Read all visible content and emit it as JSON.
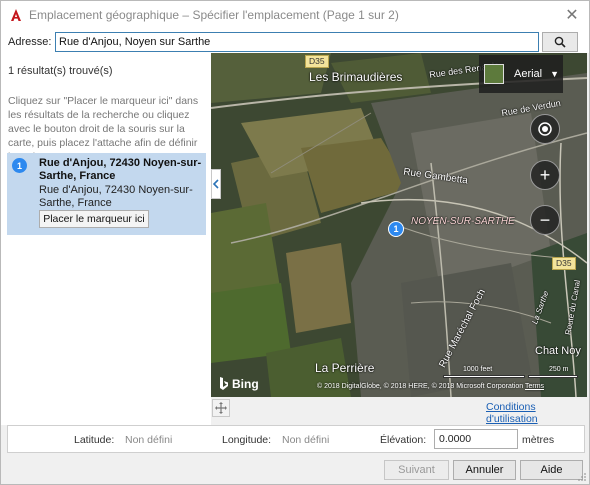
{
  "window": {
    "title": "Emplacement géographique – Spécifier l'emplacement (Page 1 sur 2)",
    "close_glyph": "✕",
    "app_icon": "autocad-a-icon",
    "accent": "#c4161c"
  },
  "address": {
    "label": "Adresse:",
    "value": "Rue d'Anjou, Noyen sur Sarthe",
    "search_icon": "search-icon"
  },
  "results": {
    "count_text": "1 résultat(s) trouvé(s)",
    "instructions": "Cliquez sur \"Placer le marqueur ici\" dans les résultats de la recherche ou cliquez avec le bouton droit de la souris sur la carte, puis placez l'attache afin de définir l'emplacement.",
    "items": [
      {
        "num": "1",
        "title": "Rue d'Anjou, 72430 Noyen-sur-Sarthe, France",
        "address": "Rue d'Anjou, 72430 Noyen-sur-Sarthe, France",
        "button": "Placer le marqueur ici"
      }
    ]
  },
  "map": {
    "style_label": "Aerial",
    "pin_label": "1",
    "labels": {
      "brimaudieres": "Les Brimaudières",
      "rue_des_renards": "Rue des Renards",
      "rue_de_verdun": "Rue de Verdun",
      "rue_gambetta": "Rue Gambetta",
      "noyen": "NOYEN-SUR-SARTHE",
      "rue_marechal_foch": "Rue Maréchal Foch",
      "la_perriere": "La Perrière",
      "route_du_canal": "Route du Canal",
      "la_sarthe": "La Sarthe",
      "chat_noy": "Chat Noy"
    },
    "roads": {
      "d35_top": "D35",
      "d35_right": "D35"
    },
    "bing": "Bing",
    "copyright": "© 2018 DigitalGlobe, © 2018 HERE, © 2018 Microsoft Corporation",
    "terms": "Terms",
    "scale_feet": "1000 feet",
    "scale_m": "250 m",
    "colors": {
      "aerial_base": "#3f4a33",
      "pin": "#2d89ef"
    }
  },
  "conditions_link": "Conditions d'utilisation",
  "coordinates": {
    "latitude_label": "Latitude:",
    "latitude_value": "Non défini",
    "longitude_label": "Longitude:",
    "longitude_value": "Non défini",
    "elevation_label": "Élévation:",
    "elevation_value": "0.0000",
    "elevation_unit": "mètres"
  },
  "buttons": {
    "next": "Suivant",
    "cancel": "Annuler",
    "help": "Aide"
  }
}
